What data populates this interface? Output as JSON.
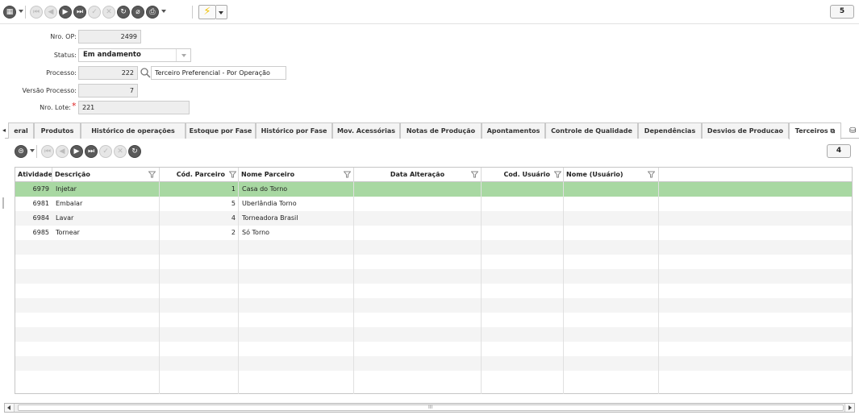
{
  "toolbar": {
    "counter": "5",
    "icons": [
      "grid-menu-icon",
      "first-icon",
      "prev-icon",
      "next-icon",
      "last-icon",
      "confirm-icon",
      "cancel-icon",
      "refresh-icon",
      "attach-icon",
      "print-icon",
      "lightning-icon"
    ]
  },
  "form": {
    "nro_op_label": "Nro. OP:",
    "nro_op_value": "2499",
    "status_label": "Status:",
    "status_value": "Em andamento",
    "processo_label": "Processo:",
    "processo_value": "222",
    "processo_desc": "Terceiro Preferencial - Por Operação",
    "versao_label": "Versão Processo:",
    "versao_value": "7",
    "lote_label": "Nro. Lote:",
    "lote_value": "221"
  },
  "tabs": {
    "scroll_left": "◂",
    "items": [
      {
        "label": "eral"
      },
      {
        "label": "Produtos"
      },
      {
        "label": "Histórico de operações"
      },
      {
        "label": "Estoque por Fase"
      },
      {
        "label": "Histórico por Fase"
      },
      {
        "label": "Mov. Acessórias"
      },
      {
        "label": "Notas de Produção"
      },
      {
        "label": "Apontamentos"
      },
      {
        "label": "Controle de Qualidade"
      },
      {
        "label": "Dependências"
      },
      {
        "label": "Desvios de Producao"
      },
      {
        "label": "Terceiros"
      }
    ]
  },
  "subtoolbar": {
    "counter": "4"
  },
  "grid": {
    "columns": [
      "Atividade",
      "Descrição",
      "Cód. Parceiro",
      "Nome Parceiro",
      "Data Alteração",
      "Cod. Usuário",
      "Nome (Usuário)"
    ],
    "rows": [
      {
        "atividade": "6979",
        "descricao": "Injetar",
        "cod_parceiro": "1",
        "nome_parceiro": "Casa do Torno"
      },
      {
        "atividade": "6981",
        "descricao": "Embalar",
        "cod_parceiro": "5",
        "nome_parceiro": "Uberlândia Torno"
      },
      {
        "atividade": "6984",
        "descricao": "Lavar",
        "cod_parceiro": "4",
        "nome_parceiro": "Torneadora Brasil"
      },
      {
        "atividade": "6985",
        "descricao": "Tornear",
        "cod_parceiro": "2",
        "nome_parceiro": "Só Torno"
      }
    ]
  },
  "scrollbar": {
    "grip": "III"
  },
  "colors": {
    "selected_row": "#a8d8a2",
    "lightning": "#f0c000"
  }
}
